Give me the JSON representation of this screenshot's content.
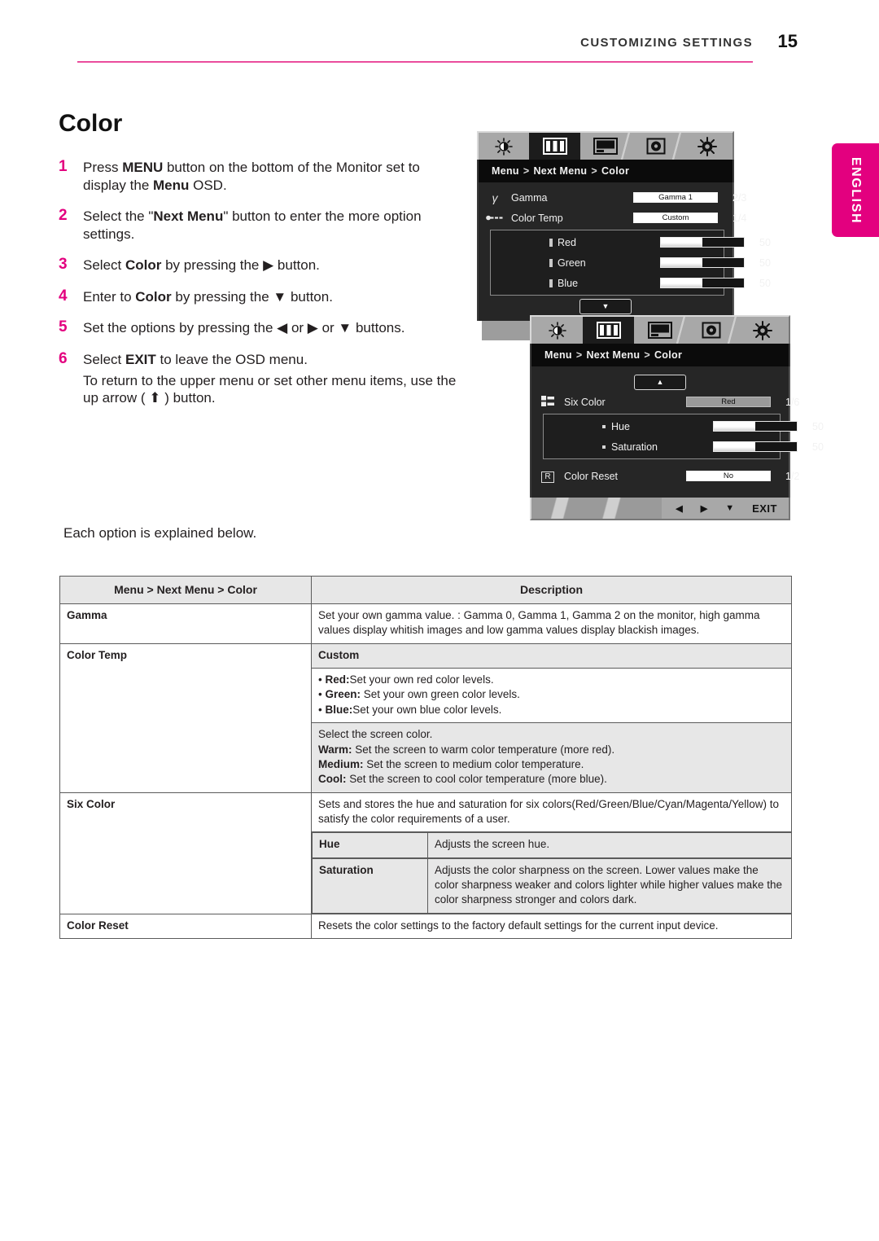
{
  "header": {
    "title": "CUSTOMIZING SETTINGS",
    "page_number": "15",
    "accent_color": "#ea4c9c"
  },
  "language_tab": {
    "label": "ENGLISH",
    "color": "#e3007f"
  },
  "headline": "Color",
  "steps": [
    {
      "num": "1",
      "parts": [
        {
          "t": "Press ",
          "b": false
        },
        {
          "t": "MENU",
          "b": true
        },
        {
          "t": " button on the bottom of the Monitor set to display the ",
          "b": false
        },
        {
          "t": "Menu",
          "b": true
        },
        {
          "t": " OSD.",
          "b": false
        }
      ]
    },
    {
      "num": "2",
      "parts": [
        {
          "t": "Select the \"",
          "b": false
        },
        {
          "t": "Next Menu",
          "b": true
        },
        {
          "t": "\" button to enter the more option settings.",
          "b": false
        }
      ]
    },
    {
      "num": "3",
      "parts": [
        {
          "t": "Select ",
          "b": false
        },
        {
          "t": "Color",
          "b": true
        },
        {
          "t": " by pressing the ▶ button.",
          "b": false
        }
      ]
    },
    {
      "num": "4",
      "parts": [
        {
          "t": "Enter to ",
          "b": false
        },
        {
          "t": "Color",
          "b": true
        },
        {
          "t": " by pressing the ▼ button.",
          "b": false
        }
      ]
    },
    {
      "num": "5",
      "parts": [
        {
          "t": "Set the options by pressing the ◀ or ▶ or ▼ buttons.",
          "b": false
        }
      ]
    },
    {
      "num": "6",
      "parts": [
        {
          "t": "Select ",
          "b": false
        },
        {
          "t": "EXIT",
          "b": true
        },
        {
          "t": " to leave the OSD menu.",
          "b": false
        }
      ],
      "note": "To return to the upper menu or set other menu items, use the up arrow ( ⬆ ) button."
    }
  ],
  "each_option_note": "Each option is explained below.",
  "osd_top": {
    "tabs": [
      {
        "icon": "brightness-icon",
        "selected": false
      },
      {
        "icon": "color-bars-icon",
        "selected": true
      },
      {
        "icon": "picture-icon",
        "selected": false
      },
      {
        "icon": "disc-icon",
        "selected": false
      },
      {
        "icon": "gear-icon",
        "selected": false
      }
    ],
    "breadcrumb": [
      "Menu",
      "Next Menu",
      "Color"
    ],
    "separator": ">",
    "rows": [
      {
        "icon": "gamma-icon",
        "glyph": "γ",
        "label": "Gamma",
        "control": "chip",
        "chip_text": "Gamma 1",
        "chip_style": "white",
        "value": "2/3"
      },
      {
        "icon": "color-temp-icon",
        "glyph": "⟵",
        "label": "Color Temp",
        "control": "chip",
        "chip_text": "Custom",
        "chip_style": "white",
        "value": "1/4"
      }
    ],
    "group": [
      {
        "marker": "sq",
        "label": "Red",
        "control": "bar",
        "fill_pct": 50,
        "value": "50"
      },
      {
        "marker": "sq",
        "label": "Green",
        "control": "bar",
        "fill_pct": 50,
        "value": "50"
      },
      {
        "marker": "sq",
        "label": "Blue",
        "control": "bar",
        "fill_pct": 50,
        "value": "50"
      }
    ],
    "nav_arrow": "▼"
  },
  "osd_bottom": {
    "tabs": [
      {
        "icon": "brightness-icon",
        "selected": false
      },
      {
        "icon": "color-bars-icon",
        "selected": true
      },
      {
        "icon": "picture-icon",
        "selected": false
      },
      {
        "icon": "disc-icon",
        "selected": false
      },
      {
        "icon": "gear-icon",
        "selected": false
      }
    ],
    "breadcrumb": [
      "Menu",
      "Next Menu",
      "Color"
    ],
    "separator": ">",
    "nav_arrow": "▲",
    "rows": [
      {
        "icon": "six-color-icon",
        "label": "Six Color",
        "control": "chip",
        "chip_text": "Red",
        "chip_style": "gray",
        "value": "1/6"
      }
    ],
    "group": [
      {
        "marker": "dot",
        "label": "Hue",
        "control": "bar",
        "fill_pct": 50,
        "value": "50"
      },
      {
        "marker": "dot",
        "label": "Saturation",
        "control": "bar",
        "fill_pct": 50,
        "value": "50"
      }
    ],
    "reset_row": {
      "icon": "reset-r-icon",
      "glyph": "R",
      "label": "Color Reset",
      "chip_text": "No",
      "chip_style": "white",
      "value": "1/2"
    },
    "footer_keys": [
      "⬆",
      "◀",
      "▶",
      "▼",
      "EXIT"
    ]
  },
  "table": {
    "headers": [
      "Menu > Next Menu > Color",
      "Description"
    ],
    "rows": {
      "gamma": {
        "key": "Gamma",
        "desc": "Set your own gamma value. : Gamma 0, Gamma 1, Gamma 2 on the monitor, high gamma values display whitish images and low gamma values display blackish images."
      },
      "color_temp": {
        "key": "Color Temp",
        "custom_label": "Custom",
        "bullets": [
          {
            "name": "Red:",
            "text": "Set your own red color levels."
          },
          {
            "name": "Green:",
            "text": " Set your own green color levels."
          },
          {
            "name": "Blue:",
            "text": "Set your own blue color levels."
          }
        ],
        "screen_intro": "Select the screen color.",
        "presets": [
          {
            "name": "Warm:",
            "text": " Set the screen to warm color temperature (more red)."
          },
          {
            "name": "Medium:",
            "text": " Set the screen to medium color temperature."
          },
          {
            "name": "Cool:",
            "text": " Set the screen to cool color temperature (more blue)."
          }
        ]
      },
      "six_color": {
        "key": "Six Color",
        "desc": "Sets and stores the hue and saturation for six colors(Red/Green/Blue/Cyan/Magenta/Yellow) to satisfy the color requirements of a user.",
        "sub": [
          {
            "key": "Hue",
            "desc": "Adjusts the screen hue."
          },
          {
            "key": "Saturation",
            "desc": "Adjusts the color sharpness on the screen. Lower values make the color sharpness weaker and colors lighter while higher values make the color sharpness stronger and colors dark."
          }
        ]
      },
      "color_reset": {
        "key": "Color Reset",
        "desc": "Resets the color settings to the factory default settings for the current input device."
      }
    }
  }
}
